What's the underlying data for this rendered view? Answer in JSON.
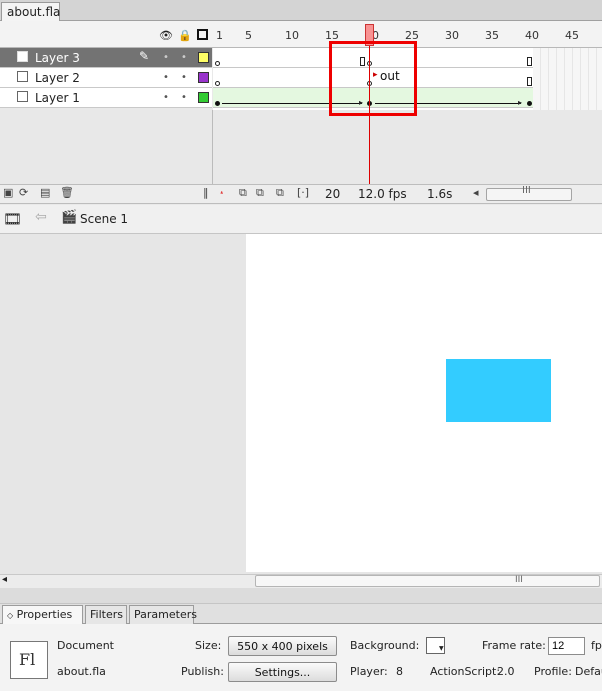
{
  "document_tab": {
    "label": "about.fla"
  },
  "timeline": {
    "frame_numbers": [
      "1",
      "5",
      "10",
      "15",
      "20",
      "25",
      "30",
      "35",
      "40",
      "45"
    ],
    "layers": [
      {
        "name": "Layer 3",
        "color": "#ffff66",
        "selected": true
      },
      {
        "name": "Layer 2",
        "color": "#9933cc",
        "selected": false
      },
      {
        "name": "Layer 1",
        "color": "#33cc33",
        "selected": false
      }
    ],
    "frame_label": "out",
    "current_frame": "20",
    "frame_rate": "12.0 fps",
    "elapsed_time": "1.6s",
    "playhead_frame": 20,
    "total_frames": 40
  },
  "edit_bar": {
    "scene_label": "Scene 1"
  },
  "stage": {
    "rect_color": "#33ccff"
  },
  "properties": {
    "tabs": [
      "Properties",
      "Filters",
      "Parameters"
    ],
    "logo_text": "Fl",
    "doc_type": "Document",
    "doc_name": "about.fla",
    "size_label": "Size:",
    "size_value": "550 x 400 pixels",
    "publish_label": "Publish:",
    "settings_button": "Settings...",
    "background_label": "Background:",
    "frame_rate_label": "Frame rate:",
    "frame_rate_value": "12",
    "frame_rate_unit": "fps",
    "player_label": "Player:",
    "player_value": "8",
    "actionscript_label": "ActionScript:",
    "actionscript_value": "2.0",
    "profile_label": "Profile:",
    "profile_value": "Default"
  }
}
